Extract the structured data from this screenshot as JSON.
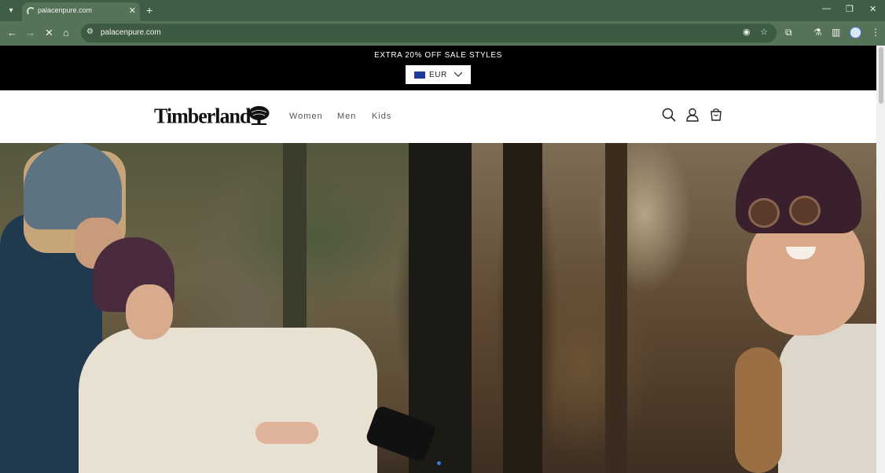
{
  "browser": {
    "tab_title": "palacenpure.com",
    "url": "palacenpure.com",
    "new_tab_glyph": "+",
    "close_glyph": "✕"
  },
  "promo": {
    "text": "EXTRA 20% OFF SALE STYLES",
    "currency": "EUR"
  },
  "header": {
    "logo": "Timberland",
    "nav": [
      "Women",
      "Men",
      "Kids"
    ]
  },
  "icons": [
    "search-icon",
    "account-icon",
    "cart-icon"
  ],
  "colors": {
    "chrome": "#3f5e45",
    "toolbar": "#567257",
    "promo_bg": "#000000",
    "carousel_dot": "#2f7de1"
  }
}
